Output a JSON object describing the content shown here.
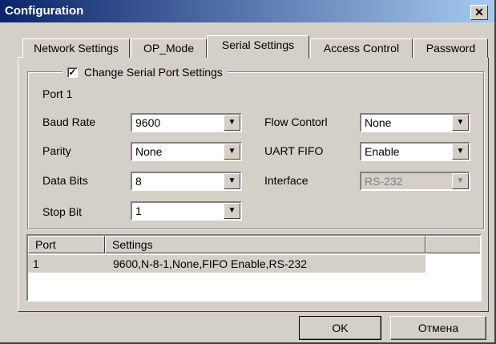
{
  "window": {
    "title": "Configuration",
    "close_glyph": "✕"
  },
  "tabs": [
    {
      "label": "Network Settings"
    },
    {
      "label": "OP_Mode"
    },
    {
      "label": "Serial Settings"
    },
    {
      "label": "Access Control"
    },
    {
      "label": "Password"
    }
  ],
  "group": {
    "checkbox_checked": true,
    "check_glyph": "✓",
    "title": "Change Serial Port Settings",
    "port_label": "Port 1"
  },
  "fields": {
    "baud_rate": {
      "label": "Baud Rate",
      "value": "9600"
    },
    "parity": {
      "label": "Parity",
      "value": "None"
    },
    "data_bits": {
      "label": "Data Bits",
      "value": "8"
    },
    "stop_bit": {
      "label": "Stop Bit",
      "value": "1"
    },
    "flow_control": {
      "label": "Flow Contorl",
      "value": "None"
    },
    "uart_fifo": {
      "label": "UART FIFO",
      "value": "Enable"
    },
    "interface": {
      "label": "Interface",
      "value": "RS-232",
      "disabled": true
    }
  },
  "dropdown_glyph": "▼",
  "list": {
    "columns": [
      "Port",
      "Settings"
    ],
    "rows": [
      {
        "port": "1",
        "settings": "9600,N-8-1,None,FIFO Enable,RS-232"
      }
    ]
  },
  "buttons": {
    "ok": "OK",
    "cancel": "Отмена"
  }
}
